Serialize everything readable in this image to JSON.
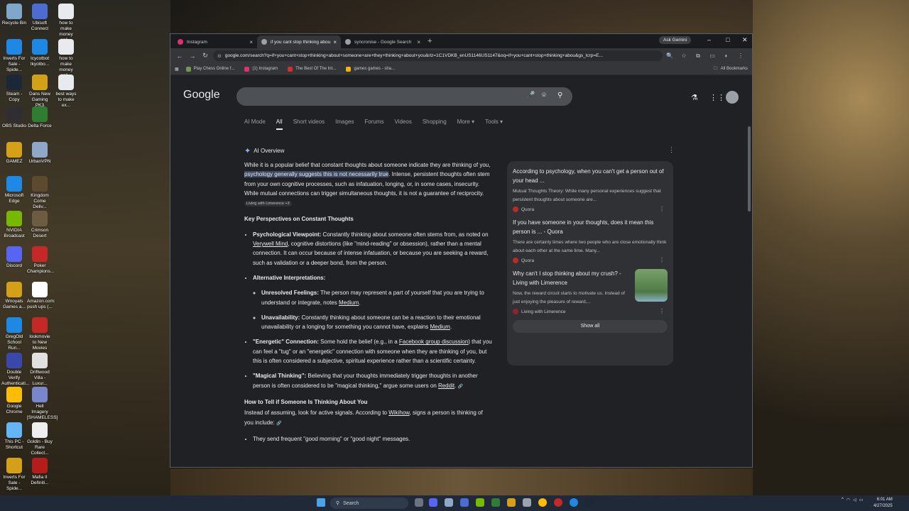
{
  "desktop": {
    "icons": [
      {
        "label": "Recycle Bin",
        "color": "#7fa7c9"
      },
      {
        "label": "Ubisoft Connect",
        "color": "#4b6cd1"
      },
      {
        "label": "how to make money onli...",
        "color": "#e8eaed"
      },
      {
        "label": "Inverts For Sale - Spide...",
        "color": "#1e88e5"
      },
      {
        "label": "Icycotbot Ikyotbo...",
        "color": "#1e88e5"
      },
      {
        "label": "how to make money onli...",
        "color": "#e8eaed"
      },
      {
        "label": "Steam - Copy",
        "color": "#1b2838"
      },
      {
        "label": "Dans New Gaming PK3",
        "color": "#d4a017"
      },
      {
        "label": "best ways to make ex...",
        "color": "#e8eaed"
      },
      {
        "label": "OBS Studio",
        "color": "#302e31"
      },
      {
        "label": "Delta Force",
        "color": "#2e7d32"
      },
      {
        "label": "GAMEZ",
        "color": "#d4a017"
      },
      {
        "label": "UrbanVPN",
        "color": "#8fa8c8"
      },
      {
        "label": "Microsoft Edge",
        "color": "#1e88e5"
      },
      {
        "label": "Kingdom Come Deliv...",
        "color": "#5d4a2e"
      },
      {
        "label": "NVIDIA Broadcast",
        "color": "#76b900"
      },
      {
        "label": "Crimson Desert",
        "color": "#6d5b42"
      },
      {
        "label": "Discord",
        "color": "#5865f2"
      },
      {
        "label": "Poker Champions...",
        "color": "#c62828"
      },
      {
        "label": "Wnoyals Games a...",
        "color": "#d4a017"
      },
      {
        "label": "Amazon.com: push ups (...",
        "color": "#ffffff"
      },
      {
        "label": "GregOld School Run...",
        "color": "#1e88e5"
      },
      {
        "label": "lookmovie to New Movies",
        "color": "#c62828"
      },
      {
        "label": "Double Verify Authenticati...",
        "color": "#3949ab"
      },
      {
        "label": "Driftwood Villa - Luxur...",
        "color": "#e0e0e0"
      },
      {
        "label": "Google Chrome",
        "color": "#fbbc04"
      },
      {
        "label": "Hell Imagery [SHAMELESS]",
        "color": "#7986cb"
      },
      {
        "label": "This PC - Shortcut",
        "color": "#64b5f6"
      },
      {
        "label": "Goldin - Buy Rare Collect...",
        "color": "#eeeeee"
      },
      {
        "label": "Inverts For Sale - Spide...",
        "color": "#d4a017"
      },
      {
        "label": "Mafia II Definiti...",
        "color": "#b71c1c"
      }
    ]
  },
  "browser": {
    "tabs": [
      {
        "title": "Instagram",
        "favicon_color": "#e1306c",
        "active": false
      },
      {
        "title": "if you cant stop thinking about",
        "favicon_color": "#9aa0a6",
        "active": true
      },
      {
        "title": "syncronise - Google Search",
        "favicon_color": "#9aa0a6",
        "active": false
      }
    ],
    "new_tab": "+",
    "ask_gemini": "Ask Gemini",
    "url": "google.com/search?q=if+you+cant+stop+thinking+about+someone+are+they+thinking+about+you&rlz=1C1VDKB_enUS1146US1147&oq=if+you+cant+stop+thinking+abou&gs_lcrp=E...",
    "bookmarks": [
      {
        "label": "Play Chess Online f...",
        "color": "#769656"
      },
      {
        "label": "(1) Instagram",
        "color": "#e1306c"
      },
      {
        "label": "The Best Of The Int...",
        "color": "#d32f2f"
      },
      {
        "label": "games games - sha...",
        "color": "#f4b400"
      }
    ],
    "all_bookmarks": "All Bookmarks"
  },
  "google": {
    "logo": "Google",
    "nav_tabs": [
      "AI Mode",
      "All",
      "Short videos",
      "Images",
      "Forums",
      "Videos",
      "Shopping",
      "More ▾",
      "Tools ▾"
    ],
    "active_tab": "All",
    "ai_overview": {
      "heading": "AI Overview",
      "intro_pre": "While it is a popular belief that constant thoughts about someone indicate they are thinking of you, ",
      "intro_hl": "psychology generally suggests this is not necessarily true",
      "intro_post": ". Intense, persistent thoughts often stem from your own cognitive processes, such as infatuation, longing, or, in some cases, insecurity. While mutual connections can trigger simultaneous thoughts, it is not a guarantee of reciprocity.",
      "intro_chip": "Living with Limerence +3",
      "h1": "Key Perspectives on Constant Thoughts",
      "b1_title": "Psychological Viewpoint:",
      "b1_text_a": " Constantly thinking about someone often stems from, as noted on ",
      "b1_link": "Verywell Mind",
      "b1_text_b": ", cognitive distortions (like \"mind-reading\" or obsession), rather than a mental connection. It can occur because of intense infatuation, or because you are seeking a reward, such as validation or a deeper bond, from the person.",
      "b2_title": "Alternative Interpretations:",
      "s1_title": "Unresolved Feelings:",
      "s1_text": " The person may represent a part of yourself that you are trying to understand or integrate, notes ",
      "s1_link": "Medium",
      "s2_title": "Unavailability:",
      "s2_text": " Constantly thinking about someone can be a reaction to their emotional unavailability or a longing for something you cannot have, explains ",
      "s2_link": "Medium",
      "b3_title": "\"Energetic\" Connection:",
      "b3_text_a": " Some hold the belief (e.g., in a ",
      "b3_link": "Facebook group discussion",
      "b3_text_b": ") that you can feel a \"tug\" or an \"energetic\" connection with someone when they are thinking of you, but this is often considered a subjective, spiritual experience rather than a scientific certainty.",
      "b4_title": "\"Magical Thinking\":",
      "b4_text": " Believing that your thoughts immediately trigger thoughts in another person is often considered to be \"magical thinking,\" argue some users on ",
      "b4_link": "Reddit",
      "h2": "How to Tell if Someone Is Thinking About You",
      "p2_a": "Instead of assuming, look for active signals. According to ",
      "p2_link": "Wikihow",
      "p2_b": ", signs a person is thinking of you include:",
      "b5": "They send frequent \"good morning\" or \"good night\" messages."
    },
    "sources": [
      {
        "title": "According to psychology, when you can't get a person out of your head ...",
        "desc": "Mutual Thoughts Theory: While many personal experiences suggest that persistent thoughts about someone are...",
        "site": "Quora",
        "site_color": "#b92b27"
      },
      {
        "title": "If you have someone in your thoughts, does it mean this person is ... - Quora",
        "desc": "There are certainly times where two people who are close emotionally think about each other at the same time. Many...",
        "site": "Quora",
        "site_color": "#b92b27"
      },
      {
        "title": "Why can't I stop thinking about my crush? - Living with Limerence",
        "desc": "Now, the reward circuit starts to motivate us. Instead of just enjoying the pleasure of reward,...",
        "site": "Living with Limerence",
        "site_color": "#8e2430"
      }
    ],
    "show_all": "Show all"
  },
  "taskbar": {
    "search": "Search",
    "time": "6:01 AM",
    "date": "4/27/2025"
  }
}
